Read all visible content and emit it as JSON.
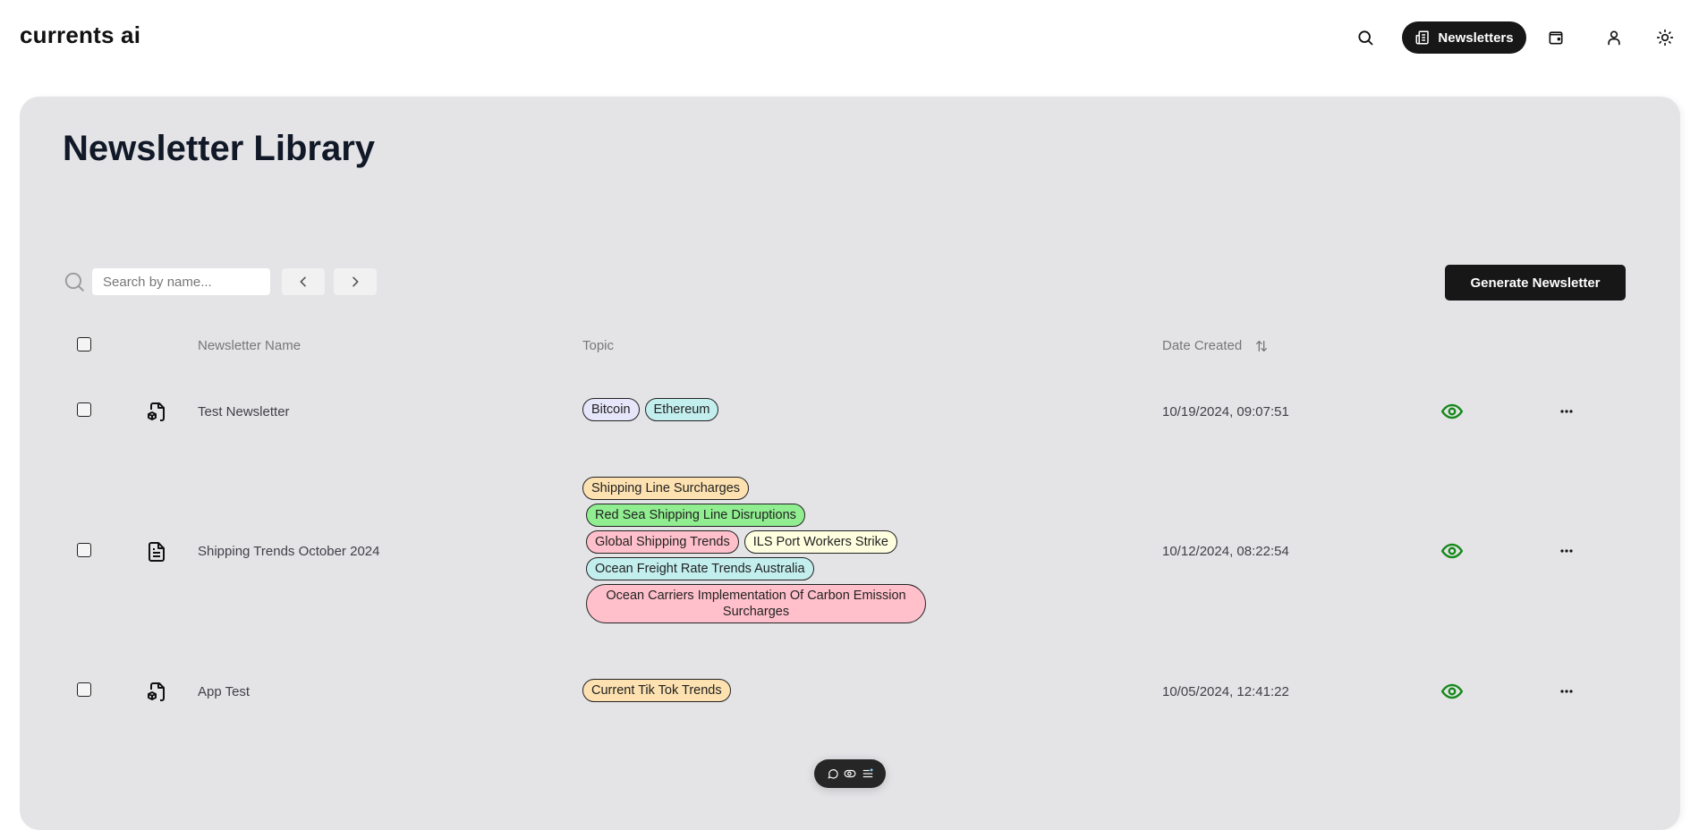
{
  "app": {
    "logo": "currents ai",
    "nav": {
      "search_icon": "search-icon",
      "active_label": "Newsletters",
      "active_icon": "newspaper-icon",
      "items": [
        {
          "name": "wallet",
          "icon": "wallet-icon"
        },
        {
          "name": "profile",
          "icon": "user-icon"
        },
        {
          "name": "theme",
          "icon": "sun-icon"
        }
      ]
    }
  },
  "page": {
    "title": "Newsletter Library",
    "search": {
      "placeholder": "Search by name...",
      "value": ""
    },
    "pagination": {
      "prev_icon": "chevron-left-icon",
      "next_icon": "chevron-right-icon"
    },
    "generate_button": "Generate Newsletter"
  },
  "table": {
    "columns": {
      "name": "Newsletter Name",
      "topic": "Topic",
      "date": "Date Created",
      "date_sort_icon": "sort-arrows-icon"
    },
    "rows": [
      {
        "icon": "file-box-icon",
        "name": "Test Newsletter",
        "topics": [
          [
            {
              "label": "Bitcoin",
              "color": "#e6e6fa"
            },
            {
              "label": "Ethereum",
              "color": "#c3eeee"
            }
          ]
        ],
        "date": "10/19/2024, 09:07:51",
        "view_icon": "eye-icon",
        "more_icon": "more-horizontal-icon"
      },
      {
        "icon": "file-text-icon",
        "name": "Shipping Trends October 2024",
        "topics": [
          [
            {
              "label": "Shipping Line Surcharges",
              "color": "#fde1b0"
            }
          ],
          [
            {
              "label": "Red Sea Shipping Line Disruptions",
              "color": "#90ee90"
            }
          ],
          [
            {
              "label": "Global Shipping Trends",
              "color": "#ffc0cb"
            },
            {
              "label": "ILS Port Workers Strike",
              "color": "#ffffe0"
            }
          ],
          [
            {
              "label": "Ocean Freight Rate Trends Australia",
              "color": "#c3eeee"
            }
          ],
          [
            {
              "label": "Ocean Carriers Implementation Of Carbon Emission Surcharges",
              "color": "#ffc0cb"
            }
          ]
        ],
        "date": "10/12/2024, 08:22:54",
        "view_icon": "eye-icon",
        "more_icon": "more-horizontal-icon"
      },
      {
        "icon": "file-box-icon",
        "name": "App Test",
        "topics": [
          [
            {
              "label": "Current Tik Tok Trends",
              "color": "#fde1b0"
            }
          ]
        ],
        "date": "10/05/2024, 12:41:22",
        "view_icon": "eye-icon",
        "more_icon": "more-horizontal-icon"
      }
    ]
  },
  "dock": {
    "items": [
      "chat-icon",
      "toggle-icon",
      "menu-icon"
    ]
  },
  "colors": {
    "accent_dark": "#171717",
    "panel_bg": "#e4e4e7",
    "view_green": "#15891a"
  }
}
